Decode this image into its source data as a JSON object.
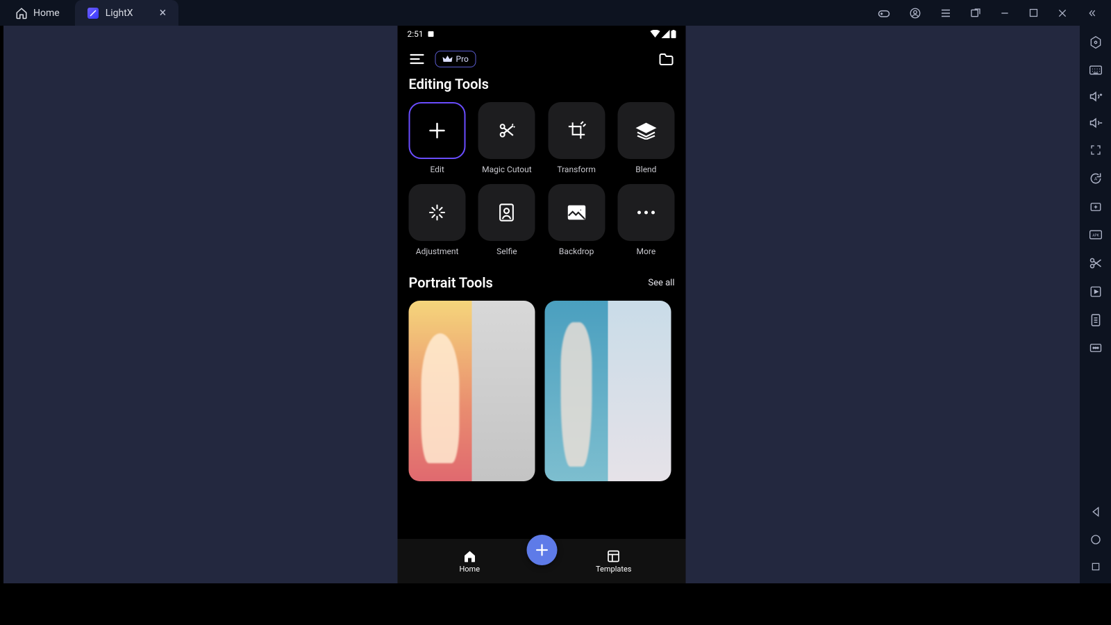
{
  "titlebar": {
    "home": "Home",
    "tab_label": "LightX"
  },
  "status": {
    "time": "2:51"
  },
  "app": {
    "pro_label": "Pro"
  },
  "sections": {
    "editing_title": "Editing Tools",
    "portrait_title": "Portrait Tools",
    "see_all": "See all"
  },
  "tools": [
    {
      "label": "Edit",
      "icon": "plus",
      "highlight": true
    },
    {
      "label": "Magic Cutout",
      "icon": "scissors-magic"
    },
    {
      "label": "Transform",
      "icon": "crop"
    },
    {
      "label": "Blend",
      "icon": "layers"
    },
    {
      "label": "Adjustment",
      "icon": "sparkle"
    },
    {
      "label": "Selfie",
      "icon": "portrait"
    },
    {
      "label": "Backdrop",
      "icon": "image"
    },
    {
      "label": "More",
      "icon": "dots"
    }
  ],
  "bottom_nav": {
    "home": "Home",
    "templates": "Templates"
  }
}
